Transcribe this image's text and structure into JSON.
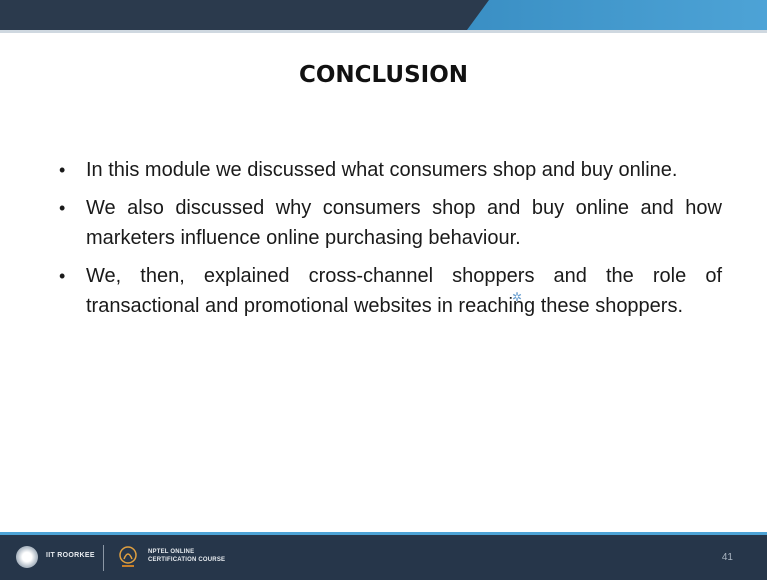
{
  "slide": {
    "title": "CONCLUSION",
    "bullets": [
      "In this module we discussed what consumers shop and buy online.",
      "We also discussed why consumers shop and buy online and how marketers influence online purchasing behaviour.",
      "We, then, explained cross-channel shoppers and the role of transactional and promotional websites in reaching these shoppers."
    ],
    "bullet_symbol": "•"
  },
  "footer": {
    "institute": "IIT ROORKEE",
    "course_line1": "NPTEL ONLINE",
    "course_line2": "CERTIFICATION COURSE",
    "page_number": "41"
  },
  "colors": {
    "header_dark": "#2b3a4d",
    "header_accent": "#4da3d6",
    "footer_bg": "#26364a"
  }
}
